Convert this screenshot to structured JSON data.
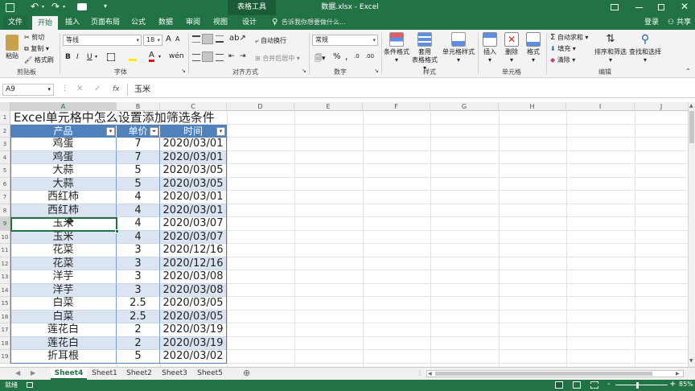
{
  "titlebar": {
    "filename": "数据.xlsx - Excel",
    "context_tab": "表格工具",
    "icons": [
      "save-icon",
      "undo-icon",
      "redo-icon",
      "camera-icon",
      "qat-more-icon",
      "ribbon-display-icon",
      "minimize-icon",
      "restore-icon",
      "close-icon"
    ]
  },
  "tabs": {
    "items": [
      "文件",
      "开始",
      "插入",
      "页面布局",
      "公式",
      "数据",
      "审阅",
      "视图",
      "设计"
    ],
    "tell_me": "告诉我你想要做什么...",
    "signin": "登录",
    "share": "共享"
  },
  "ribbon": {
    "clipboard": {
      "paste": "粘贴",
      "cut": "剪切",
      "copy": "复制",
      "format_painter": "格式刷",
      "label": "剪贴板"
    },
    "font": {
      "name": "等线",
      "size": "18",
      "bold": "B",
      "italic": "I",
      "underline": "U",
      "font_color_glyph": "A",
      "label": "字体"
    },
    "alignment": {
      "wrap": "自动换行",
      "merge": "合并后居中",
      "label": "对齐方式"
    },
    "number": {
      "format": "常规",
      "percent": "%",
      "comma": ",",
      "label": "数字"
    },
    "styles": {
      "conditional": "条件格式",
      "table_format_1": "套用",
      "table_format_2": "表格格式",
      "cell_styles": "单元格样式",
      "label": "样式"
    },
    "cells": {
      "insert": "插入",
      "delete": "删除",
      "format": "格式",
      "label": "单元格"
    },
    "editing": {
      "autosum": "自动求和",
      "fill": "填充",
      "clear": "清除",
      "sort_filter": "排序和筛选",
      "find_select": "查找和选择",
      "label": "编辑"
    }
  },
  "formula_bar": {
    "name_box": "A9",
    "fx": "fx",
    "value": "玉米"
  },
  "columns": [
    "A",
    "B",
    "C",
    "D",
    "E",
    "F",
    "G",
    "H",
    "I",
    "J"
  ],
  "rows": [
    "1",
    "2",
    "3",
    "4",
    "5",
    "6",
    "7",
    "8",
    "9",
    "10",
    "11",
    "12",
    "13",
    "14",
    "15",
    "16",
    "17",
    "18",
    "19"
  ],
  "sheet": {
    "title": "Excel单元格中怎么设置添加筛选条件",
    "headers": [
      "产品",
      "单价",
      "时间"
    ],
    "data": [
      [
        "鸡蛋",
        "7",
        "2020/03/01"
      ],
      [
        "鸡蛋",
        "7",
        "2020/03/01"
      ],
      [
        "大蒜",
        "5",
        "2020/03/05"
      ],
      [
        "大蒜",
        "5",
        "2020/03/05"
      ],
      [
        "西红柿",
        "4",
        "2020/03/01"
      ],
      [
        "西红柿",
        "4",
        "2020/03/01"
      ],
      [
        "玉米",
        "4",
        "2020/03/07"
      ],
      [
        "玉米",
        "4",
        "2020/03/07"
      ],
      [
        "花菜",
        "3",
        "2020/12/16"
      ],
      [
        "花菜",
        "3",
        "2020/12/16"
      ],
      [
        "洋芋",
        "3",
        "2020/03/08"
      ],
      [
        "洋芋",
        "3",
        "2020/03/08"
      ],
      [
        "白菜",
        "2.5",
        "2020/03/05"
      ],
      [
        "白菜",
        "2.5",
        "2020/03/05"
      ],
      [
        "莲花白",
        "2",
        "2020/03/19"
      ],
      [
        "莲花白",
        "2",
        "2020/03/19"
      ],
      [
        "折耳根",
        "5",
        "2020/03/02"
      ]
    ],
    "selected_cell": "A9"
  },
  "sheet_tabs": {
    "items": [
      "Sheet4",
      "Sheet1",
      "Sheet2",
      "Sheet3",
      "Sheet5"
    ],
    "active": "Sheet4"
  },
  "status": {
    "ready": "就绪",
    "zoom": "85%",
    "minus": "-",
    "plus": "+"
  },
  "colors": {
    "excel_green": "#217346",
    "table_header": "#4f81bd",
    "table_band": "#dbe5f1"
  }
}
